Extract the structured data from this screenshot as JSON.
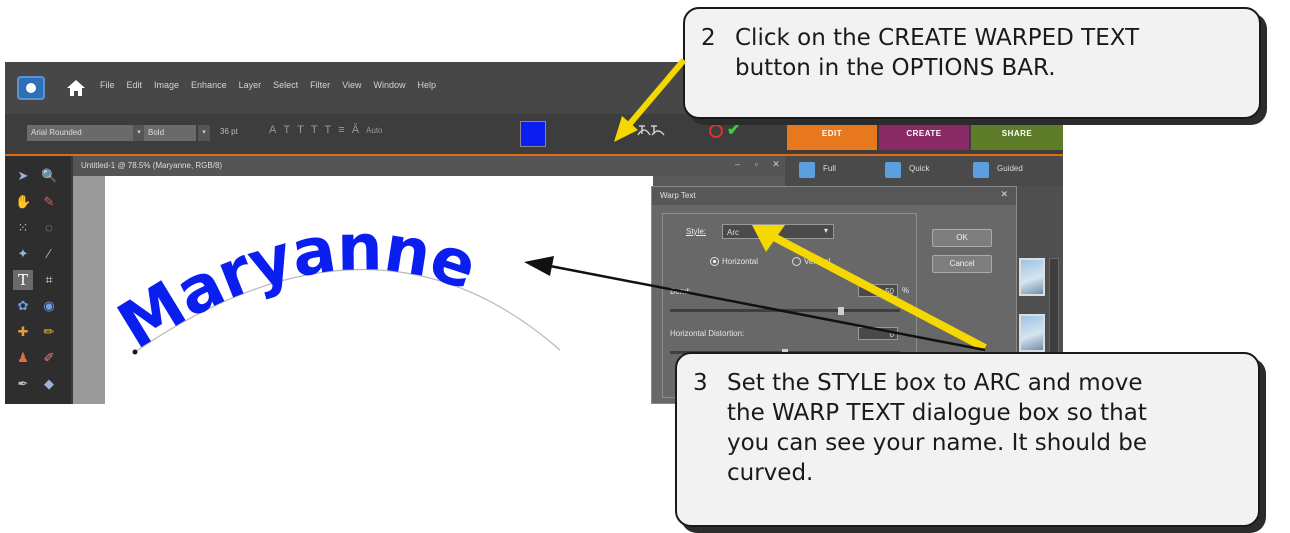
{
  "app": {
    "menu": [
      "File",
      "Edit",
      "Image",
      "Enhance",
      "Layer",
      "Select",
      "Filter",
      "View",
      "Window",
      "Help"
    ],
    "icons": {
      "logo": "elements-logo-icon",
      "home": "home-icon"
    }
  },
  "options_bar": {
    "font_family": "Arial Rounded",
    "font_style": "Bold",
    "size": "36 pt",
    "leading": "Auto",
    "color": "#0a1ef0",
    "mode_tabs": [
      "EDIT",
      "CREATE",
      "SHARE"
    ]
  },
  "document": {
    "title": "Untitled-1 @ 78.5% (Maryanne, RGB/8)",
    "warped_text": "Maryanne",
    "text_color": "#0a1ef0"
  },
  "panel": {
    "tabs": [
      "Full",
      "Quick",
      "Guided"
    ]
  },
  "warp_dialog": {
    "title": "Warp Text",
    "style_label": "Style:",
    "style_value": "Arc",
    "orientation": {
      "horizontal": "Horizontal",
      "vertical": "Vertical"
    },
    "bend_label": "Bend:",
    "bend_value": "50",
    "bend_unit": "%",
    "h_distortion_label": "Horizontal Distortion:",
    "h_distortion_value": "0",
    "ok_label": "OK",
    "cancel_label": "Cancel"
  },
  "callouts": {
    "step2": {
      "number": "2",
      "text": "Click on the CREATE WARPED TEXT\nbutton in the OPTIONS BAR."
    },
    "step3": {
      "number": "3",
      "text": "Set the STYLE box to ARC and move\nthe WARP TEXT dialogue box so that\nyou can see your name. It should be\ncurved."
    }
  }
}
